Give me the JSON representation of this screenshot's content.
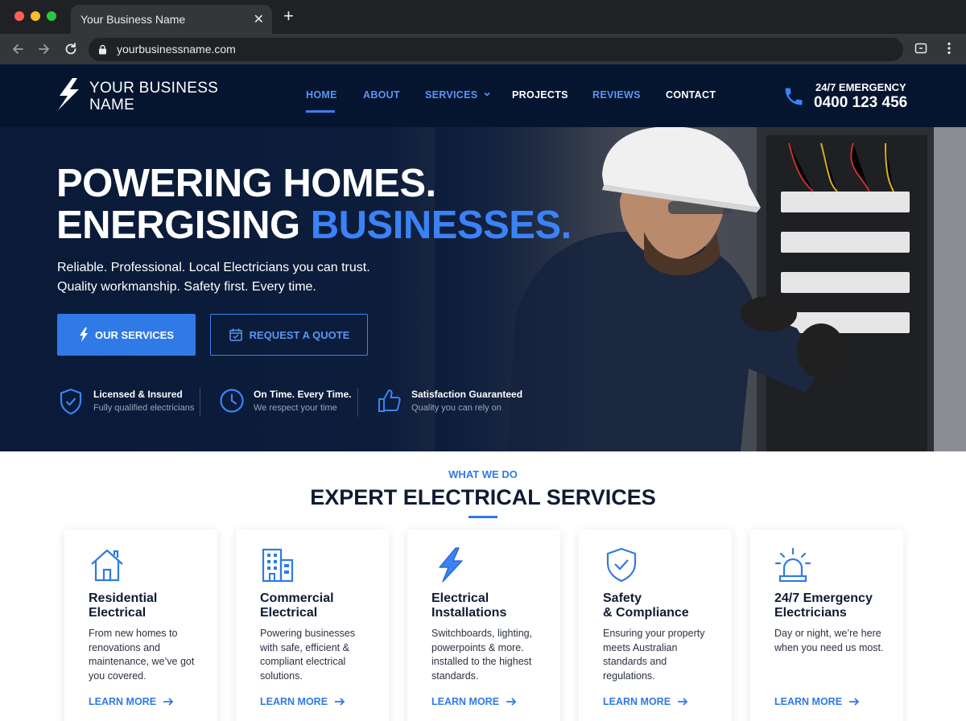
{
  "browser": {
    "tab_title": "Your Business Name",
    "tab_close": "✕",
    "new_tab": "+",
    "url": "yourbusinessname.com"
  },
  "header": {
    "logo_text": "YOUR BUSINESS NAME",
    "nav": {
      "home": "HOME",
      "about": "ABOUT",
      "services": "SERVICES",
      "projects": "PROJECTS",
      "reviews": "REVIEWS",
      "contact": "CONTACT"
    },
    "emergency_label": "24/7 EMERGENCY",
    "emergency_phone": "0400 123 456"
  },
  "hero": {
    "headline_line1": "POWERING HOMES.",
    "headline_line2_a": "ENERGISING ",
    "headline_line2_b": "BUSINESSES.",
    "subtext_line1": "Reliable. Professional. Local Electricians you can trust.",
    "subtext_line2": "Quality workmanship. Safety first. Every time.",
    "primary_button": "OUR SERVICES",
    "secondary_button": "REQUEST A QUOTE",
    "features": [
      {
        "title": "Licensed & Insured",
        "subtitle": "Fully qualified electricians",
        "icon": "shield-check-icon"
      },
      {
        "title": "On Time. Every Time.",
        "subtitle": "We respect your time",
        "icon": "clock-icon"
      },
      {
        "title": "Satisfaction Guaranteed",
        "subtitle": "Quality you can rely on",
        "icon": "thumbs-up-icon"
      }
    ]
  },
  "services": {
    "eyebrow": "WHAT WE DO",
    "title": "EXPERT ELECTRICAL SERVICES",
    "cards": [
      {
        "title_line1": "Residential",
        "title_line2": "Electrical",
        "description": "From new homes to renovations and maintenance, we’ve got you covered.",
        "link": "LEARN MORE",
        "icon": "house-icon"
      },
      {
        "title_line1": "Commercial",
        "title_line2": "Electrical",
        "description": "Powering businesses with safe, efficient & compliant electrical solutions.",
        "link": "LEARN MORE",
        "icon": "building-icon"
      },
      {
        "title_line1": "Electrical",
        "title_line2": "Installations",
        "description": "Switchboards, lighting, powerpoints & more. installed to the highest standards.",
        "link": "LEARN MORE",
        "icon": "lightning-bolt-icon"
      },
      {
        "title_line1": "Safety",
        "title_line2": "& Compliance",
        "description": "Ensuring your property meets Australian standards and regulations.",
        "link": "LEARN MORE",
        "icon": "shield-check-icon"
      },
      {
        "title_line1": "24/7 Emergency",
        "title_line2": "Electricians",
        "description": "Day or night, we’re here when you need us most.",
        "link": "LEARN MORE",
        "icon": "alarm-light-icon"
      }
    ]
  },
  "colors": {
    "accent": "#2f7ae6",
    "header_bg": "#051530",
    "heading": "#0f1b33"
  }
}
